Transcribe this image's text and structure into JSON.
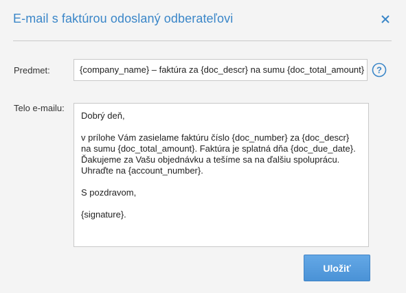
{
  "dialog": {
    "title": "E-mail s faktúrou odoslaný odberateľovi",
    "close_icon": "close-icon",
    "help_icon": "help-icon"
  },
  "form": {
    "subject_label": "Predmet:",
    "subject_value": "{company_name} – faktúra za {doc_descr} na sumu {doc_total_amount}",
    "body_label": "Telo e-mailu:",
    "body_lines": [
      "Dobrý deň,",
      "",
      "v prílohe Vám zasielame faktúru číslo {doc_number} za {doc_descr}",
      "na sumu {doc_total_amount}. Faktúra je splatná dňa {doc_due_date}.",
      "Ďakujeme za Vašu objednávku a tešíme sa na ďalšiu spoluprácu.",
      "Uhraďte na {account_number}.",
      "",
      "S pozdravom,",
      "",
      "{signature}."
    ],
    "save_label": "Uložiť"
  },
  "colors": {
    "accent": "#3a86c8",
    "button": "#4a92d6"
  }
}
